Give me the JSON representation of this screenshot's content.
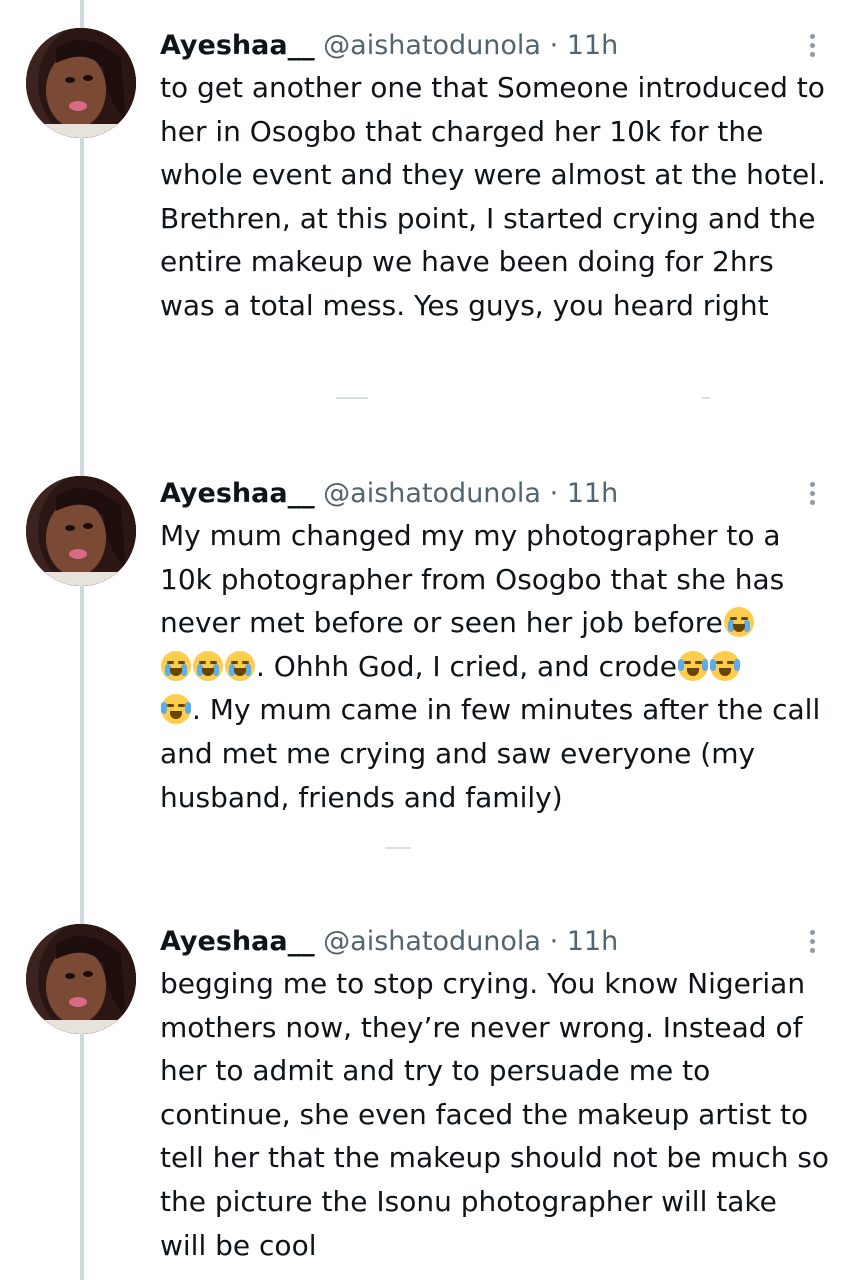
{
  "tweets": [
    {
      "display_name": "Ayeshaa__",
      "handle": "@aishatodunola",
      "time": "· 11h",
      "text": "to get another one that Someone introduced to her in Osogbo that charged her 10k for the whole event and they were almost at the hotel. Brethren, at this point, I started crying and the entire makeup we have been doing for 2hrs was a total mess. Yes guys, you heard right"
    },
    {
      "display_name": "Ayeshaa__",
      "handle": "@aishatodunola",
      "time": "· 11h",
      "text_parts": [
        "My mum changed my my photographer to a 10k photographer from Osogbo that she has never met before or seen her job before",
        ". Ohhh God, I cried, and crode",
        ". My mum came in few minutes after the call and met me crying and saw everyone (my husband, friends and family)"
      ],
      "emoji_1": "loudly-crying-face",
      "emoji_2": "face-with-tears-of-joy"
    },
    {
      "display_name": "Ayeshaa__",
      "handle": "@aishatodunola",
      "time": "· 11h",
      "text": "begging me to stop crying. You know Nigerian mothers now, they’re never wrong. Instead of her to admit and try to persuade me to continue, she even faced the makeup artist to tell her that the makeup should not be much so the picture the Isonu photographer will take will be cool"
    }
  ],
  "colors": {
    "thread_line": "#cfd9de",
    "handle_gray": "#536471",
    "text": "#0f1419"
  },
  "icons": [
    "more-vertical-icon",
    "avatar-photo"
  ]
}
